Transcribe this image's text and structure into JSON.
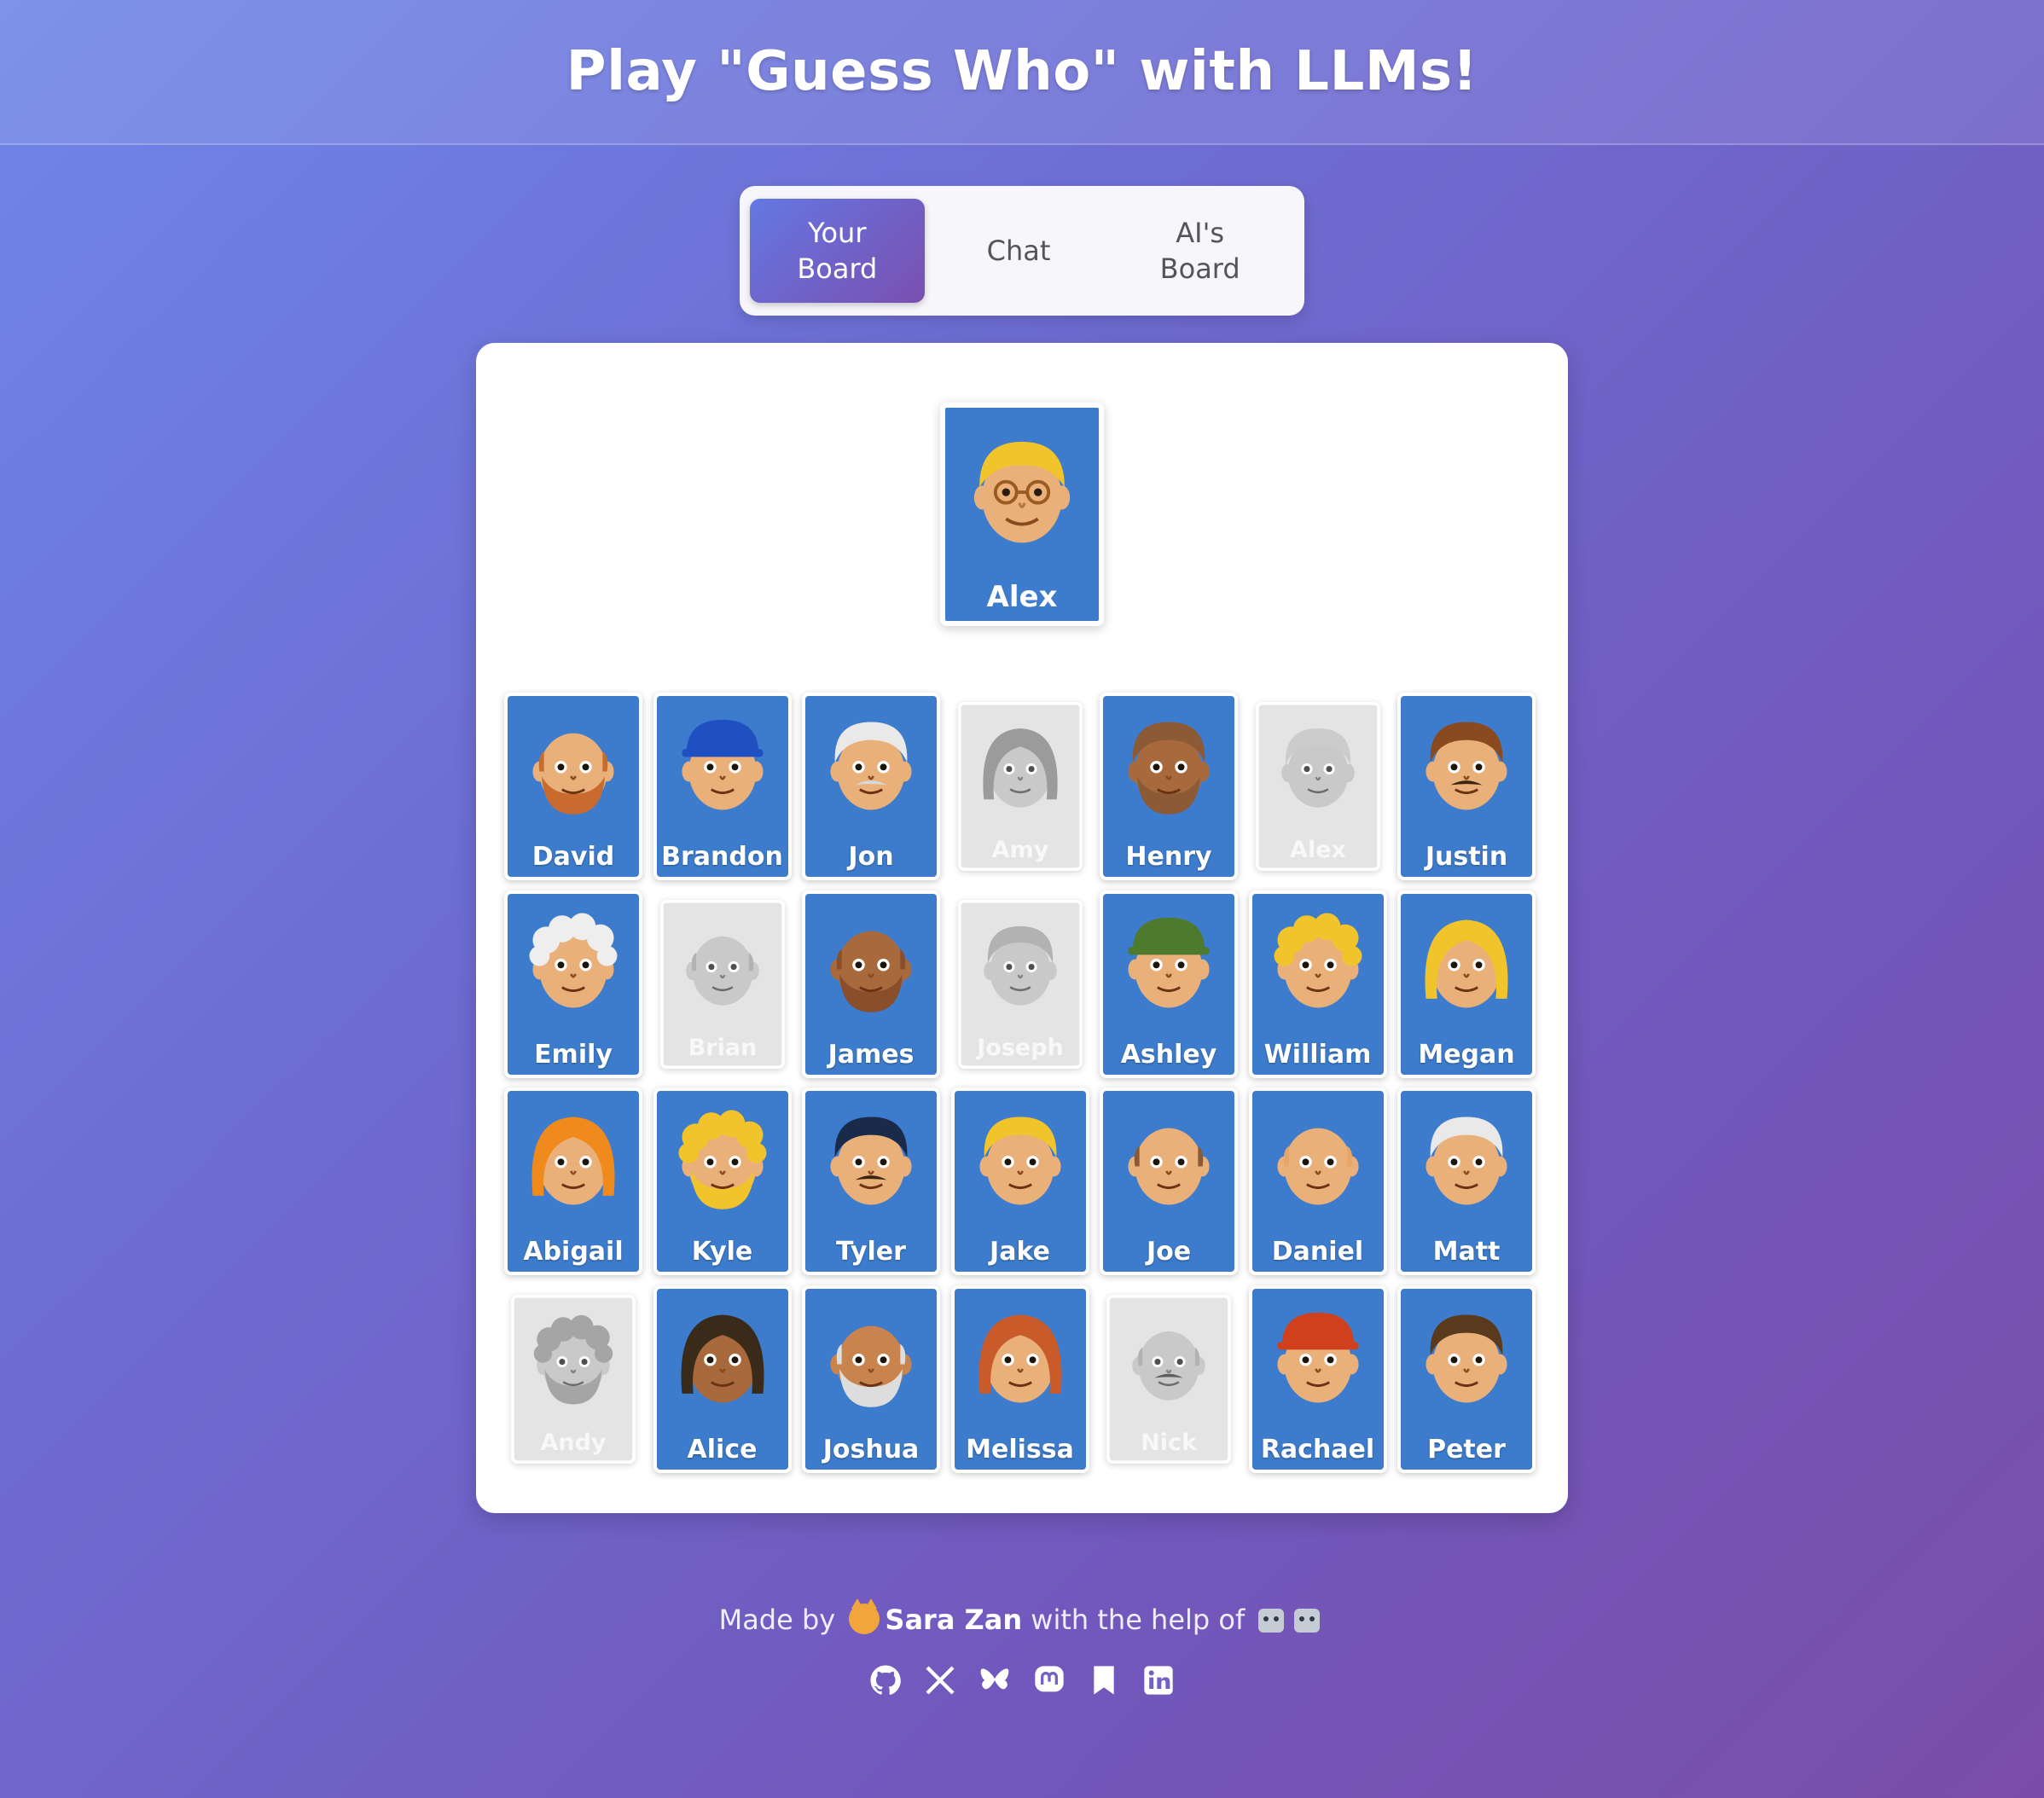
{
  "header": {
    "title": "Play \"Guess Who\" with LLMs!"
  },
  "tabs": [
    {
      "label": "Your\nBoard",
      "active": true
    },
    {
      "label": "Chat",
      "active": false
    },
    {
      "label": "AI's\nBoard",
      "active": false
    }
  ],
  "secret": {
    "name": "Alex"
  },
  "characters": [
    {
      "name": "David",
      "out": false,
      "hair": "bald",
      "color": "#c96a2e",
      "beard": true
    },
    {
      "name": "Brandon",
      "out": false,
      "hair": "cap",
      "color": "#1f4fc0"
    },
    {
      "name": "Jon",
      "out": false,
      "hair": "short",
      "color": "#e9e9e9",
      "mustache": true
    },
    {
      "name": "Amy",
      "out": true,
      "hair": "long",
      "color": "#7a7a7a"
    },
    {
      "name": "Henry",
      "out": false,
      "hair": "short",
      "color": "#8c5a35",
      "beard": true,
      "dark": true
    },
    {
      "name": "Alex",
      "out": true,
      "hair": "short",
      "color": "#bbbbbb"
    },
    {
      "name": "Justin",
      "out": false,
      "hair": "short",
      "color": "#8a4a20",
      "mustache": true
    },
    {
      "name": "Emily",
      "out": false,
      "hair": "curly",
      "color": "#eeeeee"
    },
    {
      "name": "Brian",
      "out": true,
      "hair": "bald",
      "color": "#999999"
    },
    {
      "name": "James",
      "out": false,
      "hair": "bald",
      "color": "#8a4e2a",
      "beard": true,
      "dark": true
    },
    {
      "name": "Joseph",
      "out": true,
      "hair": "short",
      "color": "#999999"
    },
    {
      "name": "Ashley",
      "out": false,
      "hair": "cap",
      "color": "#4e7a2e"
    },
    {
      "name": "William",
      "out": false,
      "hair": "curly",
      "color": "#f2c42b"
    },
    {
      "name": "Megan",
      "out": false,
      "hair": "long",
      "color": "#f2c42b"
    },
    {
      "name": "Abigail",
      "out": false,
      "hair": "long",
      "color": "#f08a1c"
    },
    {
      "name": "Kyle",
      "out": false,
      "hair": "curly",
      "color": "#f2c42b",
      "beard": true
    },
    {
      "name": "Tyler",
      "out": false,
      "hair": "short",
      "color": "#1a2a4a",
      "mustache": true
    },
    {
      "name": "Jake",
      "out": false,
      "hair": "short",
      "color": "#f2c42b"
    },
    {
      "name": "Joe",
      "out": false,
      "hair": "bald",
      "color": "#8a5a35"
    },
    {
      "name": "Daniel",
      "out": false,
      "hair": "bald",
      "color": "#e7a56a"
    },
    {
      "name": "Matt",
      "out": false,
      "hair": "short",
      "color": "#e9e9e9"
    },
    {
      "name": "Andy",
      "out": true,
      "hair": "curly",
      "color": "#888888",
      "beard": true
    },
    {
      "name": "Alice",
      "out": false,
      "hair": "long",
      "color": "#3a2a1a",
      "dark": true
    },
    {
      "name": "Joshua",
      "out": false,
      "hair": "bald",
      "color": "#dddddd",
      "beard": true,
      "darkish": true
    },
    {
      "name": "Melissa",
      "out": false,
      "hair": "long",
      "color": "#c95a2a"
    },
    {
      "name": "Nick",
      "out": true,
      "hair": "bald",
      "color": "#999999",
      "mustache": true
    },
    {
      "name": "Rachael",
      "out": false,
      "hair": "cap",
      "color": "#d0401c"
    },
    {
      "name": "Peter",
      "out": false,
      "hair": "short",
      "color": "#5a3a1c"
    }
  ],
  "footer": {
    "made_by": "Made by",
    "author": "Sara Zan",
    "help": "with the help of",
    "socials": [
      "github-icon",
      "x-icon",
      "bluesky-icon",
      "mastodon-icon",
      "bookmark-icon",
      "linkedin-icon"
    ]
  },
  "colors": {
    "card": "#3d7ccc",
    "skin": "#eab07a",
    "skin_dark": "#a86a3c"
  }
}
